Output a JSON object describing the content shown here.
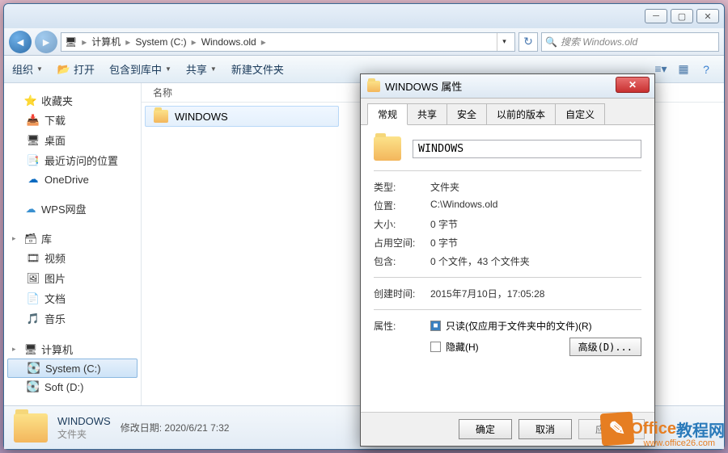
{
  "breadcrumb": {
    "root_icon": "🖥",
    "seg1": "计算机",
    "seg2": "System (C:)",
    "seg3": "Windows.old"
  },
  "search": {
    "placeholder": "搜索 Windows.old"
  },
  "toolbar": {
    "organize": "组织",
    "open": "打开",
    "include": "包含到库中",
    "share": "共享",
    "newfolder": "新建文件夹"
  },
  "fl_head": {
    "name": "名称"
  },
  "file": {
    "name": "WINDOWS"
  },
  "sidebar": {
    "fav": "收藏夹",
    "down": "下载",
    "desk": "桌面",
    "recent": "最近访问的位置",
    "onedrive": "OneDrive",
    "wps": "WPS网盘",
    "lib": "库",
    "video": "视频",
    "pic": "图片",
    "doc": "文档",
    "music": "音乐",
    "computer": "计算机",
    "sysc": "System (C:)",
    "softd": "Soft (D:)"
  },
  "details": {
    "name": "WINDOWS",
    "type": "文件夹",
    "mod_label": "修改日期:",
    "mod": "2020/6/21 7:32"
  },
  "dialog": {
    "title": "WINDOWS 属性",
    "tabs": {
      "general": "常规",
      "share": "共享",
      "security": "安全",
      "prev": "以前的版本",
      "custom": "自定义"
    },
    "name": "WINDOWS",
    "type_l": "类型:",
    "type_v": "文件夹",
    "loc_l": "位置:",
    "loc_v": "C:\\Windows.old",
    "size_l": "大小:",
    "size_v": "0 字节",
    "disk_l": "占用空间:",
    "disk_v": "0 字节",
    "cont_l": "包含:",
    "cont_v": "0 个文件，43 个文件夹",
    "ctime_l": "创建时间:",
    "ctime_v": "2015年7月10日，17:05:28",
    "attr_l": "属性:",
    "ro": "只读(仅应用于文件夹中的文件)(R)",
    "hidden": "隐藏(H)",
    "adv": "高级(D)...",
    "ok": "确定",
    "cancel": "取消",
    "apply": "应用(A)"
  },
  "watermark": {
    "t1": "Office",
    "t2": "教程网",
    "url": "www.office26.com"
  }
}
